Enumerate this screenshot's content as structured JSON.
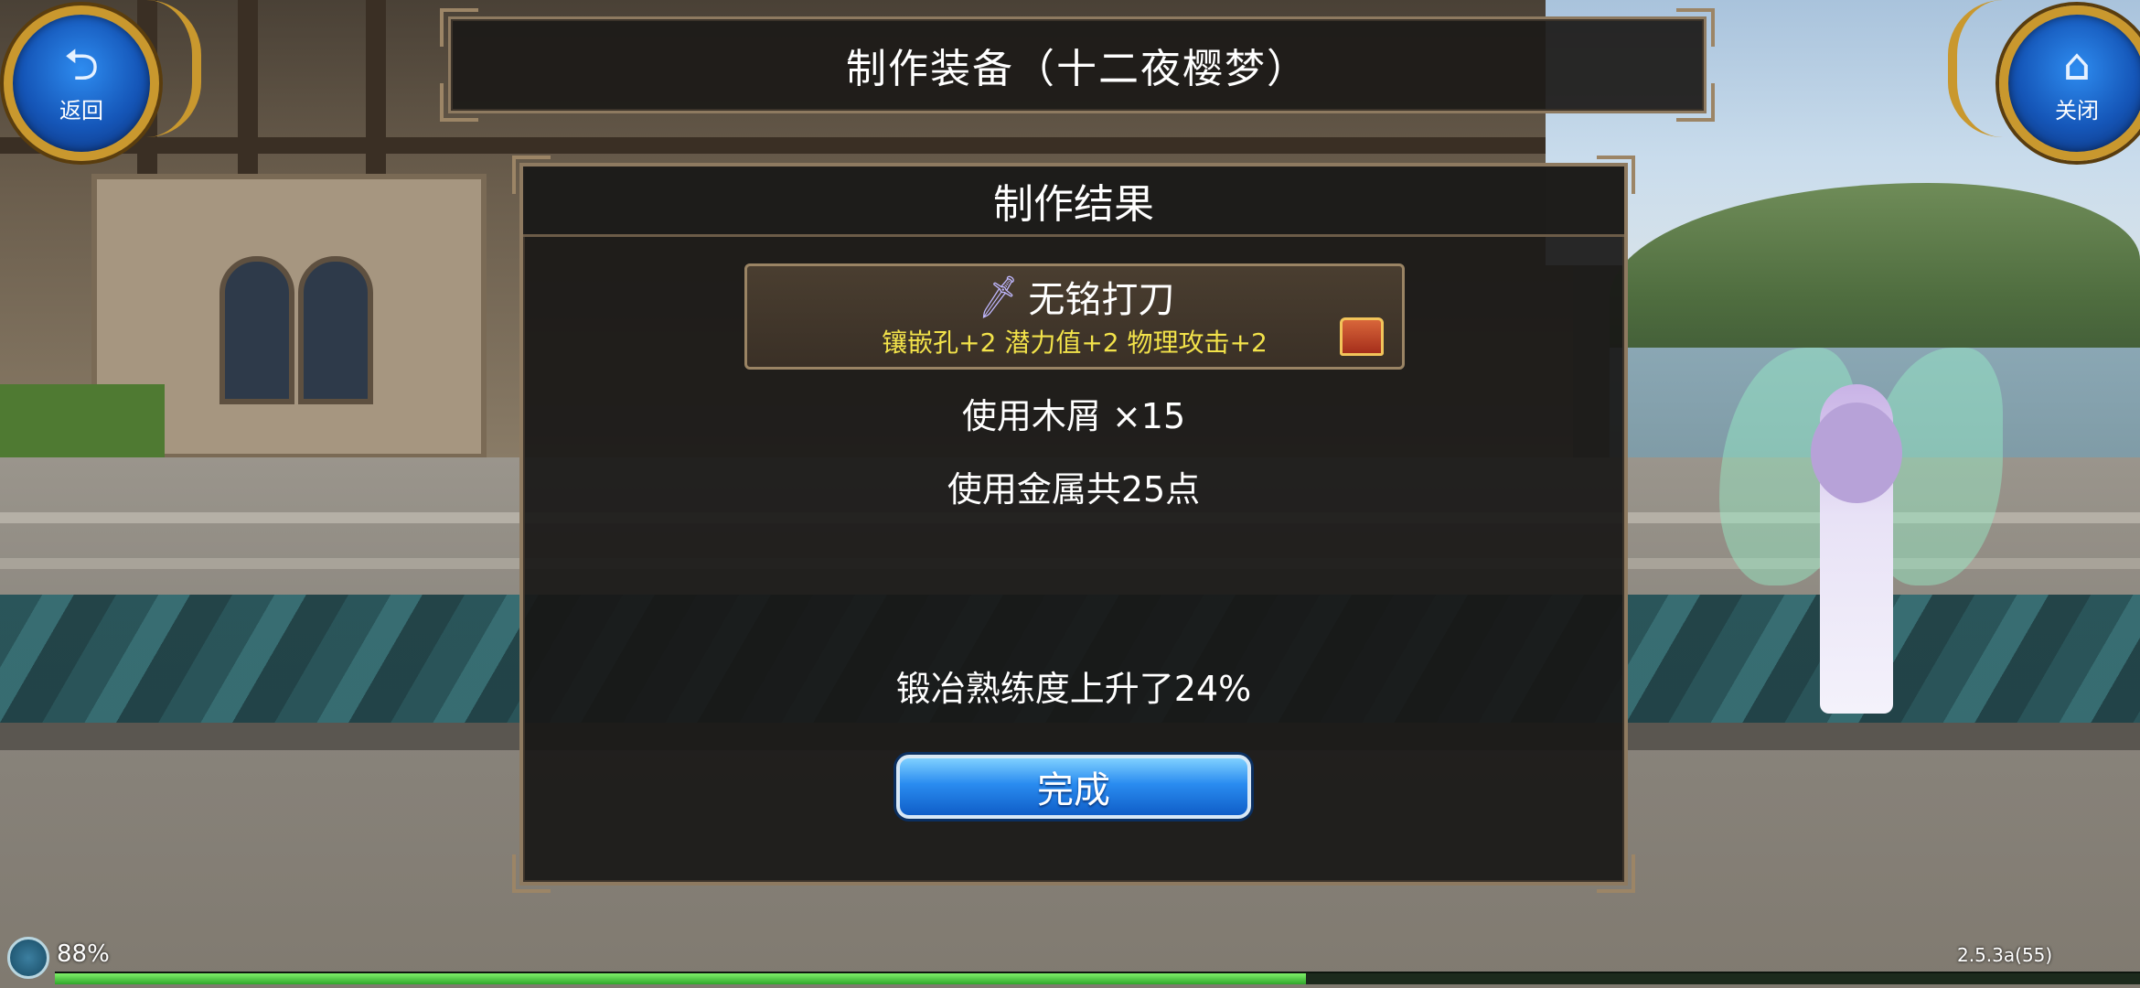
{
  "header": {
    "back_label": "返回",
    "back_icon": "return-arrow-icon",
    "close_label": "关闭",
    "close_icon": "home-icon",
    "title": "制作装备（十二夜樱梦）"
  },
  "dialog": {
    "title": "制作结果",
    "item": {
      "icon": "sword-icon",
      "name": "无铭打刀",
      "stats": "镶嵌孔+2 潜力值+2 物理攻击+2",
      "stats_color": "#f2e24a",
      "extra_icon": "treasure-chest-icon"
    },
    "materials_used": "使用木屑 ×15",
    "metal_used": "使用金属共25点",
    "skill_gain": "锻冶熟练度上升了24%",
    "done_button": "完成",
    "done_color": "#2a8cf0"
  },
  "status": {
    "battery": "88%",
    "version": "2.5.3a(55)",
    "exp_fraction": 0.6
  }
}
